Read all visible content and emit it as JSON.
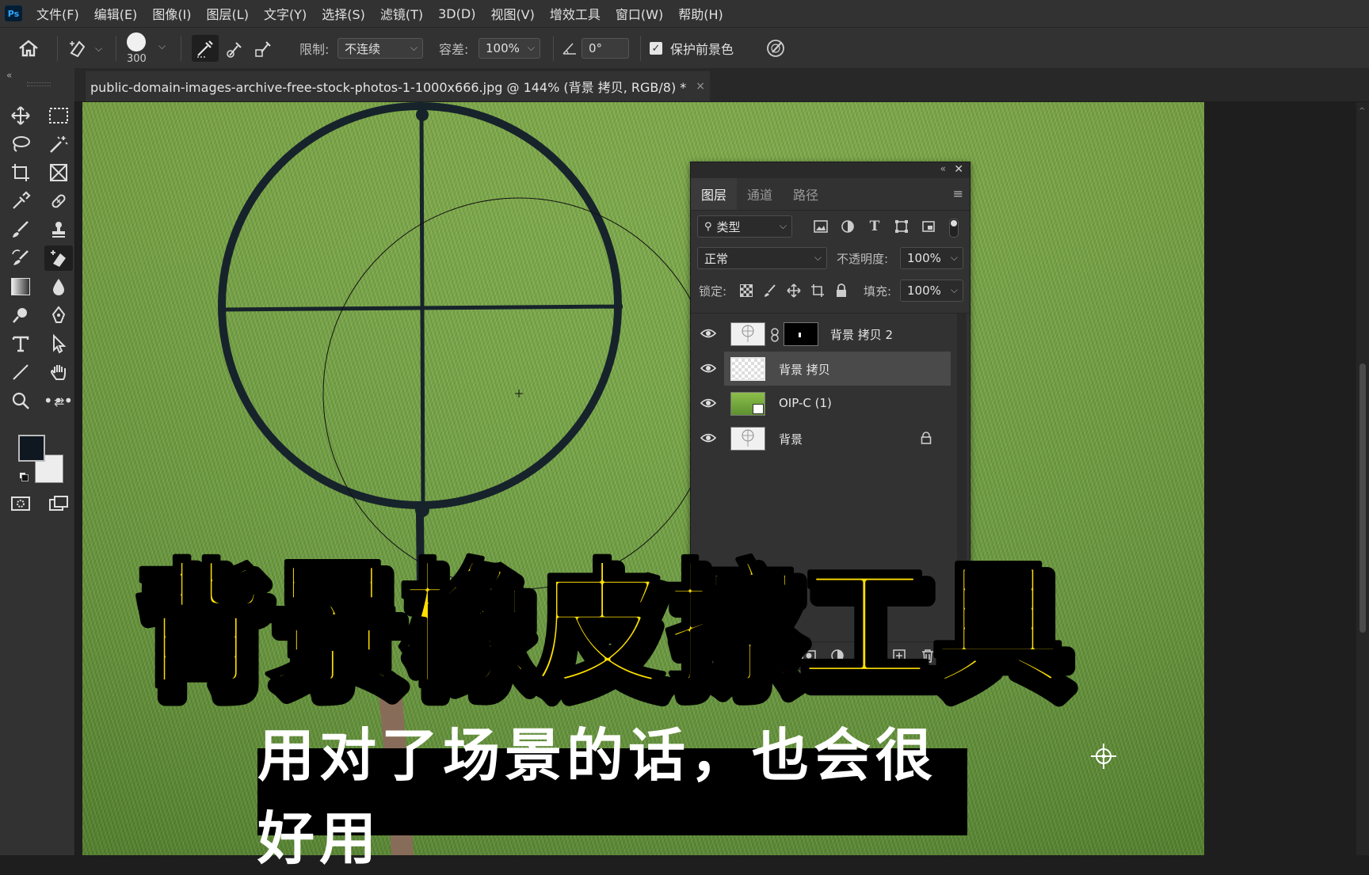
{
  "app": {
    "logo": "Ps"
  },
  "menu": [
    "文件(F)",
    "编辑(E)",
    "图像(I)",
    "图层(L)",
    "文字(Y)",
    "选择(S)",
    "滤镜(T)",
    "3D(D)",
    "视图(V)",
    "增效工具",
    "窗口(W)",
    "帮助(H)"
  ],
  "options": {
    "brush_size": "300",
    "limit_label": "限制:",
    "limit_value": "不连续",
    "tolerance_label": "容差:",
    "tolerance_value": "100%",
    "angle_value": "0°",
    "protect_fg_label": "保护前景色",
    "protect_fg_checked": true
  },
  "document": {
    "tab_title": "public-domain-images-archive-free-stock-photos-1-1000x666.jpg @ 144% (背景 拷贝, RGB/8) *",
    "close": "×"
  },
  "layers_panel": {
    "tabs": [
      "图层",
      "通道",
      "路径"
    ],
    "active_tab": "图层",
    "filter_label": "类型",
    "blend_mode": "正常",
    "opacity_label": "不透明度:",
    "opacity_value": "100%",
    "lock_label": "锁定:",
    "fill_label": "填充:",
    "fill_value": "100%",
    "layers": [
      {
        "name": "背景 拷贝 2",
        "visible": true,
        "has_mask": true,
        "selected": false,
        "locked": false
      },
      {
        "name": "背景 拷贝",
        "visible": true,
        "has_mask": false,
        "selected": true,
        "locked": false
      },
      {
        "name": "OIP-C (1)",
        "visible": true,
        "has_mask": false,
        "selected": false,
        "locked": false
      },
      {
        "name": "背景",
        "visible": true,
        "has_mask": false,
        "selected": false,
        "locked": true
      }
    ]
  },
  "overlay": {
    "title": "背景橡皮擦工具",
    "subtitle": "用对了场景的话，也会很好用",
    "title_color": "#ffe000"
  },
  "colors": {
    "foreground": "#0f1720",
    "background": "#ededed",
    "accent": "#31a8ff"
  }
}
